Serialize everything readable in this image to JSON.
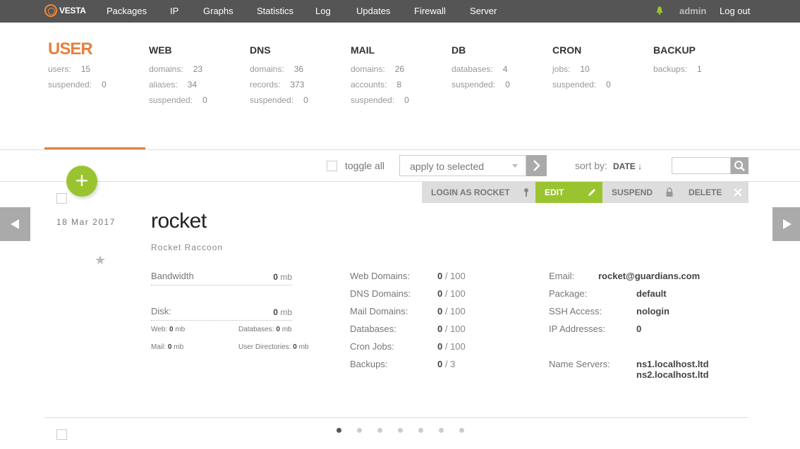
{
  "topnav": {
    "brand": "VESTA",
    "items": [
      "Packages",
      "IP",
      "Graphs",
      "Statistics",
      "Log",
      "Updates",
      "Firewall",
      "Server"
    ],
    "user": "admin",
    "logout": "Log out"
  },
  "stats": {
    "user": {
      "title": "USER",
      "rows": [
        [
          "users:",
          "15"
        ],
        [
          "suspended:",
          "0"
        ]
      ]
    },
    "web": {
      "title": "WEB",
      "rows": [
        [
          "domains:",
          "23"
        ],
        [
          "aliases:",
          "34"
        ],
        [
          "suspended:",
          "0"
        ]
      ]
    },
    "dns": {
      "title": "DNS",
      "rows": [
        [
          "domains:",
          "36"
        ],
        [
          "records:",
          "373"
        ],
        [
          "suspended:",
          "0"
        ]
      ]
    },
    "mail": {
      "title": "MAIL",
      "rows": [
        [
          "domains:",
          "26"
        ],
        [
          "accounts:",
          "8"
        ],
        [
          "suspended:",
          "0"
        ]
      ]
    },
    "db": {
      "title": "DB",
      "rows": [
        [
          "databases:",
          "4"
        ],
        [
          "suspended:",
          "0"
        ]
      ]
    },
    "cron": {
      "title": "CRON",
      "rows": [
        [
          "jobs:",
          "10"
        ],
        [
          "suspended:",
          "0"
        ]
      ]
    },
    "backup": {
      "title": "BACKUP",
      "rows": [
        [
          "backups:",
          "1"
        ]
      ]
    }
  },
  "toolbar": {
    "toggle_all": "toggle all",
    "apply_placeholder": "apply to selected",
    "sort_label": "sort by:",
    "sort_value": "DATE ↓"
  },
  "actions": {
    "login_as": "LOGIN AS ROCKET",
    "edit": "EDIT",
    "suspend": "SUSPEND",
    "delete": "DELETE"
  },
  "user": {
    "date": "18  Mar  2017",
    "username": "rocket",
    "fullname": "Rocket Raccoon",
    "bandwidth_label": "Bandwidth",
    "bandwidth_value": "0",
    "disk_label": "Disk:",
    "disk_value": "0",
    "unit": "mb",
    "disk_web_label": "Web:",
    "disk_web": "0",
    "disk_db_label": "Databases:",
    "disk_db": "0",
    "disk_mail_label": "Mail:",
    "disk_mail": "0",
    "disk_dirs_label": "User Directories:",
    "disk_dirs": "0",
    "limits": [
      {
        "label": "Web Domains:",
        "used": "0",
        "max": "100"
      },
      {
        "label": "DNS Domains:",
        "used": "0",
        "max": "100"
      },
      {
        "label": "Mail Domains:",
        "used": "0",
        "max": "100"
      },
      {
        "label": "Databases:",
        "used": "0",
        "max": "100"
      },
      {
        "label": "Cron Jobs:",
        "used": "0",
        "max": "100"
      },
      {
        "label": "Backups:",
        "used": "0",
        "max": "3"
      }
    ],
    "email_label": "Email:",
    "email": "rocket@guardians.com",
    "package_label": "Package:",
    "package": "default",
    "ssh_label": "SSH Access:",
    "ssh": "nologin",
    "ip_label": "IP Addresses:",
    "ip": "0",
    "ns_label": "Name Servers:",
    "ns1": "ns1.localhost.ltd",
    "ns2": "ns2.localhost.ltd"
  },
  "pagination": {
    "count": 7,
    "active": 0
  },
  "colors": {
    "accent": "#e5813d",
    "green": "#9ac42f",
    "topbar": "#555555"
  }
}
